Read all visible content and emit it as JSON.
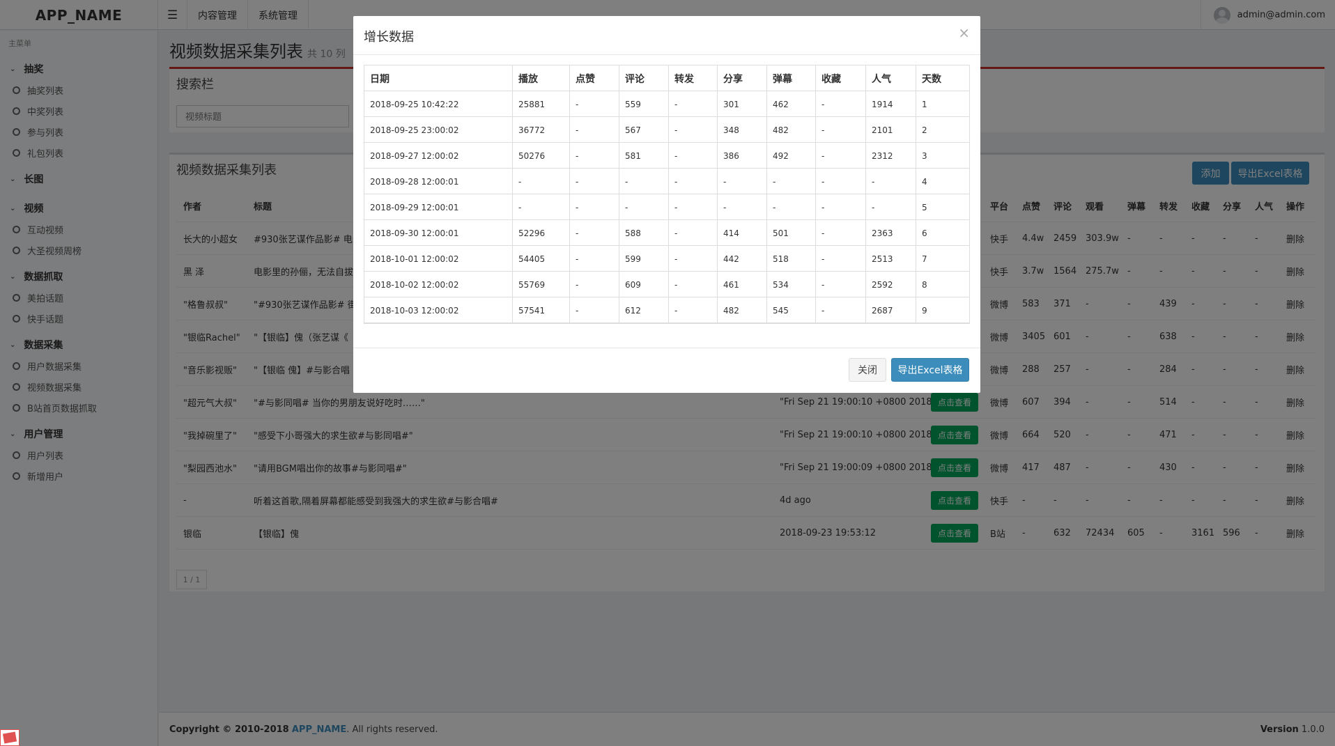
{
  "header": {
    "app_name": "APP_NAME",
    "menu": [
      "内容管理",
      "系统管理"
    ],
    "user": "admin@admin.com"
  },
  "sidebar": {
    "title": "主菜单",
    "groups": [
      {
        "label": "抽奖",
        "items": [
          "抽奖列表",
          "中奖列表",
          "参与列表",
          "礼包列表"
        ]
      },
      {
        "label": "长图",
        "items": []
      },
      {
        "label": "视频",
        "items": [
          "互动视频",
          "大圣视频周榜"
        ]
      },
      {
        "label": "数据抓取",
        "items": [
          "美拍话题",
          "快手话题"
        ]
      },
      {
        "label": "数据采集",
        "items": [
          "用户数据采集",
          "视频数据采集",
          "B站首页数据抓取"
        ]
      },
      {
        "label": "用户管理",
        "items": [
          "用户列表",
          "新增用户"
        ]
      }
    ]
  },
  "page": {
    "title": "视频数据采集列表",
    "subtitle": "共 10 列"
  },
  "search": {
    "title": "搜索栏",
    "placeholder": "视频标题"
  },
  "list": {
    "title": "视频数据采集列表",
    "add_label": "添加",
    "export_label": "导出Excel表格",
    "headers": {
      "author": "作者",
      "title": "标题",
      "platform": "平台",
      "likes": "点赞",
      "comments": "评论",
      "views": "观看",
      "danmaku": "弹幕",
      "forwards": "转发",
      "favorites": "收藏",
      "shares": "分享",
      "popularity": "人气",
      "actions": "操作"
    },
    "view_label": "点击查看",
    "delete_label": "删除",
    "rows": [
      {
        "author": "长大的小超女",
        "title": "#930张艺谋作品影# 电影",
        "time": "",
        "platform": "快手",
        "likes": "4.4w",
        "comments": "2459",
        "views": "303.9w",
        "danmaku": "-",
        "forwards": "-",
        "favorites": "-",
        "shares": "-",
        "popularity": "-"
      },
      {
        "author": "黑 泽",
        "title": "电影里的孙俪，无法自拔",
        "time": "",
        "platform": "快手",
        "likes": "3.7w",
        "comments": "1564",
        "views": "275.7w",
        "danmaku": "-",
        "forwards": "-",
        "favorites": "-",
        "shares": "-",
        "popularity": "-"
      },
      {
        "author": "\"格鲁叔叔\"",
        "title": "\"#930张艺谋作品影# 街",
        "time": "",
        "platform": "微博",
        "likes": "583",
        "comments": "371",
        "views": "-",
        "danmaku": "-",
        "forwards": "439",
        "favorites": "-",
        "shares": "-",
        "popularity": "-"
      },
      {
        "author": "\"银临Rachel\"",
        "title": "\"【银临】傀（张艺谋《",
        "time": "",
        "platform": "微博",
        "likes": "3405",
        "comments": "601",
        "views": "-",
        "danmaku": "-",
        "forwards": "638",
        "favorites": "-",
        "shares": "-",
        "popularity": "-"
      },
      {
        "author": "\"音乐影视贩\"",
        "title": "\"【银临 傀】#与影合唱",
        "time": "",
        "platform": "微博",
        "likes": "288",
        "comments": "257",
        "views": "-",
        "danmaku": "-",
        "forwards": "284",
        "favorites": "-",
        "shares": "-",
        "popularity": "-"
      },
      {
        "author": "\"超元气大叔\"",
        "title": "\"#与影同唱# 当你的男朋友说好吃时……\"",
        "time": "\"Fri Sep 21 19:00:10 +0800 2018\"",
        "platform": "微博",
        "likes": "607",
        "comments": "394",
        "views": "-",
        "danmaku": "-",
        "forwards": "514",
        "favorites": "-",
        "shares": "-",
        "popularity": "-"
      },
      {
        "author": "\"我掉碗里了\"",
        "title": "\"感受下小哥强大的求生欲#与影同唱#\"",
        "time": "\"Fri Sep 21 19:00:10 +0800 2018\"",
        "platform": "微博",
        "likes": "664",
        "comments": "520",
        "views": "-",
        "danmaku": "-",
        "forwards": "471",
        "favorites": "-",
        "shares": "-",
        "popularity": "-"
      },
      {
        "author": "\"梨园西池水\"",
        "title": "\"请用BGM唱出你的故事#与影同唱#\"",
        "time": "\"Fri Sep 21 19:00:09 +0800 2018\"",
        "platform": "微博",
        "likes": "417",
        "comments": "487",
        "views": "-",
        "danmaku": "-",
        "forwards": "430",
        "favorites": "-",
        "shares": "-",
        "popularity": "-"
      },
      {
        "author": "-",
        "title": "听着这首歌,隔着屏幕都能感受到我强大的求生欲#与影合唱#",
        "time": "4d ago",
        "platform": "快手",
        "likes": "-",
        "comments": "-",
        "views": "-",
        "danmaku": "-",
        "forwards": "-",
        "favorites": "-",
        "shares": "-",
        "popularity": "-"
      },
      {
        "author": "银临",
        "title": "【银临】傀",
        "time": "2018-09-23 19:53:12",
        "platform": "B站",
        "likes": "-",
        "comments": "632",
        "views": "72434",
        "danmaku": "605",
        "forwards": "-",
        "favorites": "3161",
        "shares": "596",
        "popularity": "-"
      }
    ],
    "pager": "1 / 1"
  },
  "footer": {
    "copyright_prefix": "Copyright © 2010-2018 ",
    "brand": "APP_NAME",
    "suffix": ". All rights reserved.",
    "version_label": "Version",
    "version": "1.0.0"
  },
  "modal": {
    "title": "增长数据",
    "close_symbol": "×",
    "headers": [
      "日期",
      "播放",
      "点赞",
      "评论",
      "转发",
      "分享",
      "弹幕",
      "收藏",
      "人气",
      "天数"
    ],
    "rows": [
      [
        "2018-09-25 10:42:22",
        "25881",
        "-",
        "559",
        "-",
        "301",
        "462",
        "-",
        "1914",
        "1"
      ],
      [
        "2018-09-25 23:00:02",
        "36772",
        "-",
        "567",
        "-",
        "348",
        "482",
        "-",
        "2101",
        "2"
      ],
      [
        "2018-09-27 12:00:02",
        "50276",
        "-",
        "581",
        "-",
        "386",
        "492",
        "-",
        "2312",
        "3"
      ],
      [
        "2018-09-28 12:00:01",
        "-",
        "-",
        "-",
        "-",
        "-",
        "-",
        "-",
        "-",
        "4"
      ],
      [
        "2018-09-29 12:00:01",
        "-",
        "-",
        "-",
        "-",
        "-",
        "-",
        "-",
        "-",
        "5"
      ],
      [
        "2018-09-30 12:00:01",
        "52296",
        "-",
        "588",
        "-",
        "414",
        "501",
        "-",
        "2363",
        "6"
      ],
      [
        "2018-10-01 12:00:02",
        "54405",
        "-",
        "599",
        "-",
        "442",
        "518",
        "-",
        "2513",
        "7"
      ],
      [
        "2018-10-02 12:00:02",
        "55769",
        "-",
        "609",
        "-",
        "461",
        "534",
        "-",
        "2592",
        "8"
      ],
      [
        "2018-10-03 12:00:02",
        "57541",
        "-",
        "612",
        "-",
        "482",
        "545",
        "-",
        "2687",
        "9"
      ]
    ],
    "close_label": "关闭",
    "export_label": "导出Excel表格"
  }
}
